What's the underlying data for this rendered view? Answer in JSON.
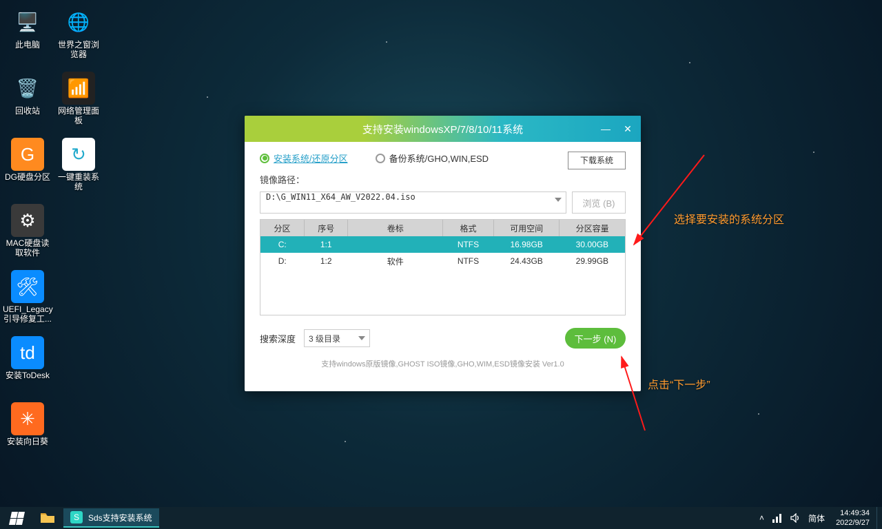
{
  "desktop_icons": [
    {
      "label": "此电脑",
      "glyph": "🖥️",
      "bg": ""
    },
    {
      "label": "世界之窗浏\n览器",
      "glyph": "🌐",
      "bg": ""
    },
    {
      "label": "回收站",
      "glyph": "🗑️",
      "bg": ""
    },
    {
      "label": "网络管理面\n板",
      "glyph": "📶",
      "bg": "#222"
    },
    {
      "label": "DG硬盘分区",
      "glyph": "G",
      "bg": "#ff8a1f"
    },
    {
      "label": "一键重装系\n统",
      "glyph": "↻",
      "bg": "#fff"
    },
    {
      "label": "MAC硬盘读\n取软件",
      "glyph": "⚙",
      "bg": "#3a3a3a"
    },
    {
      "label": "UEFI_Legacy\n引导修复工...",
      "glyph": "🛠",
      "bg": "#0a8cff"
    },
    {
      "label": "安装ToDesk",
      "glyph": "td",
      "bg": "#0a8cff"
    },
    {
      "label": "安装向日葵",
      "glyph": "✳",
      "bg": "#ff6a1f"
    }
  ],
  "icon_map": {
    "0": {
      "r": 0,
      "c": 0
    },
    "1": {
      "r": 0,
      "c": 1
    },
    "2": {
      "r": 1,
      "c": 0
    },
    "3": {
      "r": 1,
      "c": 1
    },
    "4": {
      "r": 2,
      "c": 0
    },
    "5": {
      "r": 2,
      "c": 1
    },
    "6": {
      "r": 3,
      "c": 0
    },
    "8": {
      "r": 5,
      "c": 0
    },
    "7": {
      "r": 4,
      "c": 0
    },
    "9": {
      "r": 6,
      "c": 0
    }
  },
  "dialog": {
    "title": "支持安装windowsXP/7/8/10/11系统",
    "radio": {
      "install": "安装系统/还原分区",
      "backup": "备份系统/GHO,WIN,ESD"
    },
    "download_btn": "下载系统",
    "image_path_label": "镜像路径：",
    "image_path_value": "D:\\G_WIN11_X64_AW_V2022.04.iso",
    "browse_btn": "浏览 (B)",
    "columns": [
      "分区",
      "序号",
      "卷标",
      "格式",
      "可用空间",
      "分区容量"
    ],
    "rows": [
      {
        "drive": "C:",
        "idx": "1:1",
        "vol": "",
        "fmt": "NTFS",
        "free": "16.98GB",
        "size": "30.00GB",
        "selected": true
      },
      {
        "drive": "D:",
        "idx": "1:2",
        "vol": "软件",
        "fmt": "NTFS",
        "free": "24.43GB",
        "size": "29.99GB",
        "selected": false
      }
    ],
    "depth_label": "搜索深度",
    "depth_value": "3 级目录",
    "next_btn": "下一步 (N)",
    "footer": "支持windows原版镜像,GHOST ISO镜像,GHO,WIM,ESD镜像安装 Ver1.0"
  },
  "annotations": {
    "a1": "选择要安装的系统分区",
    "a2": "点击“下一步”"
  },
  "taskbar": {
    "app_label": "Sds支持安装系统",
    "ime": "简体",
    "time": "14:49:34",
    "date": "2022/9/27"
  }
}
